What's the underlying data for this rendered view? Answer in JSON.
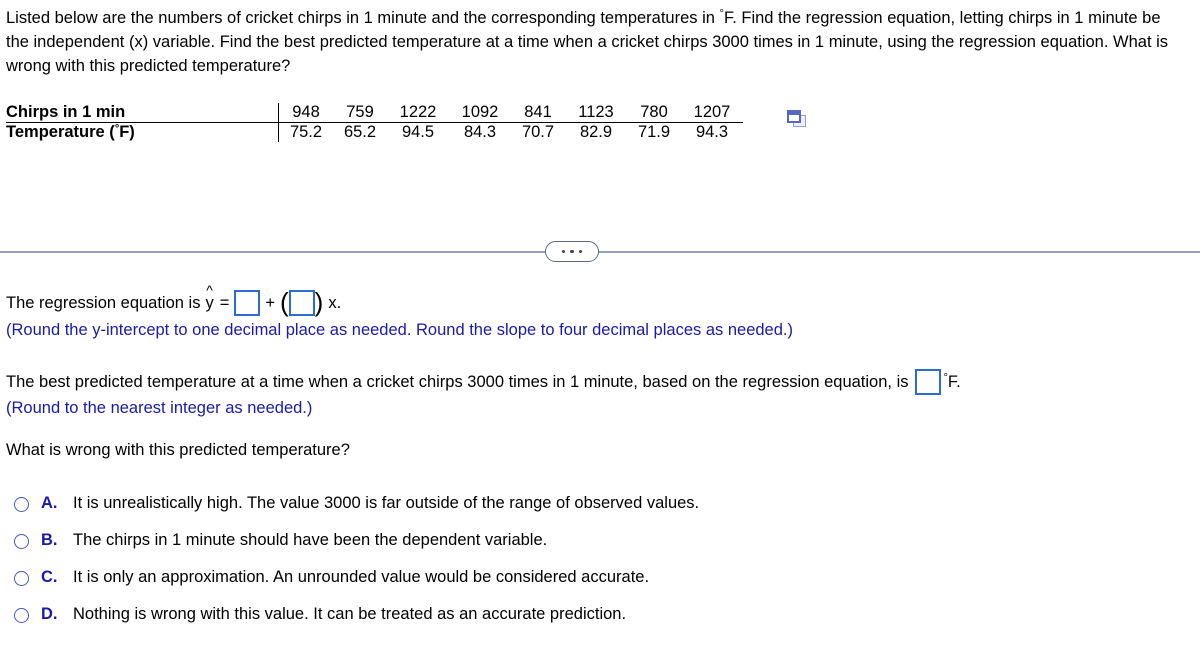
{
  "problem": {
    "text_part1": "Listed below are the numbers of cricket chirps in 1 minute and the corresponding temperatures in ",
    "degree_symbol": "°",
    "text_part2": "F. Find the regression equation, letting chirps in 1 minute be the independent (x) variable. Find the best predicted temperature at a time when a cricket chirps 3000 times in 1 minute, using the regression equation. What is wrong with this predicted temperature?"
  },
  "table": {
    "row_labels": [
      "Chirps in 1 min",
      "Temperature (°F)"
    ],
    "chirps_label_text": "Chirps in 1 min",
    "temperature_label_prefix": "Temperature (",
    "temperature_label_suffix": "F)",
    "chirps": [
      "948",
      "759",
      "1222",
      "1092",
      "841",
      "1123",
      "780",
      "1207"
    ],
    "temperature": [
      "75.2",
      "65.2",
      "94.5",
      "84.3",
      "70.7",
      "82.9",
      "71.9",
      "94.3"
    ],
    "copy_icon": "copy-to-spreadsheet-icon"
  },
  "divider": {
    "ellipsis_icon": "ellipsis-icon",
    "dots": "..."
  },
  "answers": {
    "equation_prefix": "The regression equation is",
    "y_symbol": "y",
    "hat_symbol": "^",
    "equals": "=",
    "plus": "+",
    "open_paren": "(",
    "close_paren": ")",
    "x_suffix": "x.",
    "intercept_value": "",
    "slope_value": "",
    "intercept_placeholder": "",
    "slope_placeholder": "",
    "rounding_hint_1": "(Round the y-intercept to one decimal place as needed. Round the slope to four decimal places as needed.)",
    "prediction_text": "The best predicted temperature at a time when a cricket chirps 3000 times in 1 minute, based on the regression equation, is",
    "prediction_value": "",
    "prediction_placeholder": "",
    "degree_unit_symbol": "°",
    "degree_unit_text": "F.",
    "rounding_hint_2": "(Round to the nearest integer as needed.)",
    "question": "What is wrong with this predicted temperature?"
  },
  "options": [
    {
      "letter": "A.",
      "text": "It is unrealistically high. The value 3000 is far outside of the range of observed values.",
      "selected": false
    },
    {
      "letter": "B.",
      "text": "The chirps in 1 minute should have been the dependent variable.",
      "selected": false
    },
    {
      "letter": "C.",
      "text": "It is only an approximation. An unrounded value would be considered accurate.",
      "selected": false
    },
    {
      "letter": "D.",
      "text": "Nothing is wrong with this value. It can be treated as an accurate prediction.",
      "selected": false
    }
  ],
  "colors": {
    "hint_blue": "#1a1aa8",
    "input_border_blue": "#2b6cd4",
    "radio_blue": "#4858c8",
    "divider_gray": "#97a2b6",
    "text_black": "#000000"
  }
}
